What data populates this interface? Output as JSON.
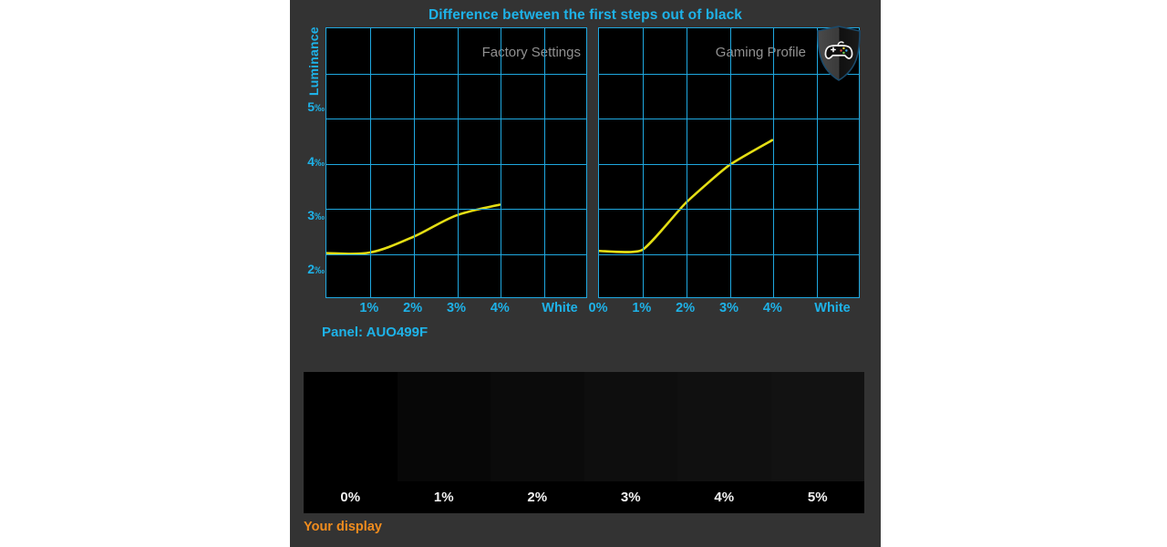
{
  "header": {
    "title": "Difference between the first steps out of black"
  },
  "axes": {
    "y_label": "Luminance",
    "y_ticks": [
      "5",
      "4",
      "3",
      "2"
    ],
    "y_unit": "‰"
  },
  "panel_info": {
    "label": "Panel: AUO499F"
  },
  "footer": {
    "your_display_label": "Your display"
  },
  "icons": {
    "shield_gamepad": "shield-gamepad-icon"
  },
  "colors": {
    "accent_cyan": "#1EB2E8",
    "grid_cyan": "#1FA8E0",
    "curve_yellow": "#E4DE14",
    "caption_gray": "#919191",
    "panel_bg": "#333333",
    "plot_bg": "#000000",
    "orange": "#F08C1E"
  },
  "ramp": {
    "labels": [
      "0%",
      "1%",
      "2%",
      "3%",
      "4%",
      "5%"
    ],
    "swatches": [
      "#000000",
      "#070707",
      "#0b0b0b",
      "#0e0e0e",
      "#101010",
      "#121212"
    ]
  },
  "chart_data": [
    {
      "type": "line",
      "title": "Factory Settings",
      "caption": "Factory Settings",
      "xlabel": "",
      "ylabel": "Luminance",
      "yunit": "‰",
      "grid": true,
      "legend": "none",
      "categories": [
        "0%",
        "1%",
        "2%",
        "3%",
        "4%",
        "White"
      ],
      "xtick_labels": [
        "1%",
        "2%",
        "3%",
        "4%",
        "White"
      ],
      "ylim": [
        1.5,
        6.5
      ],
      "yticks": [
        2,
        3,
        4,
        5
      ],
      "x": [
        0,
        1,
        2,
        3,
        4
      ],
      "values": [
        2.32,
        2.33,
        2.62,
        3.02,
        3.22
      ],
      "series": [
        {
          "name": "Factory Settings",
          "color": "#E4DE14",
          "points": [
            {
              "x": "0%",
              "y": 2.32
            },
            {
              "x": "1%",
              "y": 2.33
            },
            {
              "x": "2%",
              "y": 2.62
            },
            {
              "x": "3%",
              "y": 3.02
            },
            {
              "x": "4%",
              "y": 3.22
            }
          ]
        }
      ]
    },
    {
      "type": "line",
      "title": "Gaming Profile",
      "caption": "Gaming Profile",
      "xlabel": "",
      "ylabel": "Luminance",
      "yunit": "‰",
      "grid": true,
      "legend": "none",
      "categories": [
        "0%",
        "1%",
        "2%",
        "3%",
        "4%",
        "White"
      ],
      "xtick_labels": [
        "0%",
        "1%",
        "2%",
        "3%",
        "4%",
        "White"
      ],
      "ylim": [
        1.5,
        6.5
      ],
      "yticks": [
        2,
        3,
        4,
        5
      ],
      "x": [
        0,
        1,
        2,
        3,
        4
      ],
      "values": [
        2.36,
        2.38,
        3.25,
        3.95,
        4.42
      ],
      "series": [
        {
          "name": "Gaming Profile",
          "color": "#E4DE14",
          "points": [
            {
              "x": "0%",
              "y": 2.36
            },
            {
              "x": "1%",
              "y": 2.38
            },
            {
              "x": "2%",
              "y": 3.25
            },
            {
              "x": "3%",
              "y": 3.95
            },
            {
              "x": "4%",
              "y": 4.42
            }
          ]
        }
      ]
    }
  ]
}
